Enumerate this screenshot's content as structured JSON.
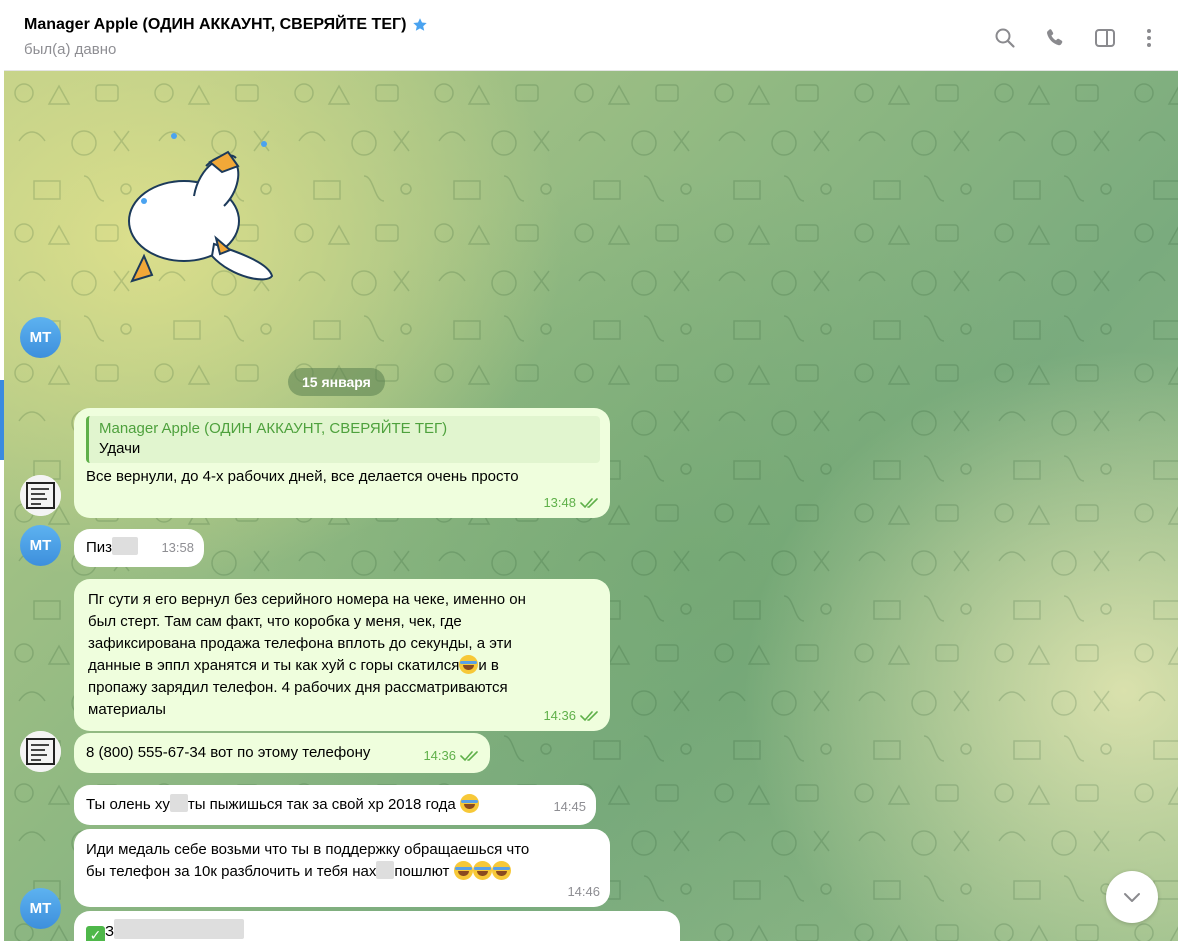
{
  "header": {
    "title": "Manager Apple (ОДИН АККАУНТ, СВЕРЯЙТЕ ТЕГ)",
    "status": "был(а) давно",
    "icons": [
      "star-icon",
      "search-icon",
      "phone-icon",
      "sidebar-icon",
      "more-icon"
    ]
  },
  "chat": {
    "date_chip": "15 января",
    "avatar_initials": "MT",
    "messages": [
      {
        "direction": "out",
        "quote_name": "Manager Apple (ОДИН АККАУНТ, СВЕРЯЙТЕ ТЕГ)",
        "quote_text": "Удачи",
        "text": "Все вернули, до 4-х рабочих дней, все делается очень просто",
        "time": "13:48"
      },
      {
        "direction": "in",
        "text_before": "Пиз",
        "time": "13:58"
      },
      {
        "direction": "out",
        "text_lines": [
          "Пг сути я его вернул без серийного номера на чеке, именно он",
          "был стерт. Там сам факт, что коробка у меня, чек, где",
          "зафиксирована продажа телефона вплоть до секунды, а эти",
          "данные в эппл хранятся и ты как хуй с горы скатился",
          "и в",
          "пропажу зарядил телефон. 4 рабочих дня рассматриваются",
          "материалы"
        ],
        "time": "14:36"
      },
      {
        "direction": "out",
        "text": "8 (800) 555-67-34 вот по этому телефону",
        "time": "14:36"
      },
      {
        "direction": "in",
        "text_before": "Ты олень ху",
        "text_after": "ты пыжишься так за свой хр 2018 года",
        "time": "14:45"
      },
      {
        "direction": "in",
        "line1": "Иди медаль себе возьми что ты в поддержку обращаешься что",
        "line2_before": "бы телефон за 10к разблочить и тебя нах",
        "line2_after": "пошлют",
        "time": "14:46"
      },
      {
        "direction": "in",
        "text_before": "З"
      }
    ]
  },
  "colors": {
    "outgoing_bubble": "#effedd",
    "incoming_bubble": "#ffffff",
    "accent_green": "#5fb04a",
    "avatar_blue": "#4a9fe6"
  }
}
